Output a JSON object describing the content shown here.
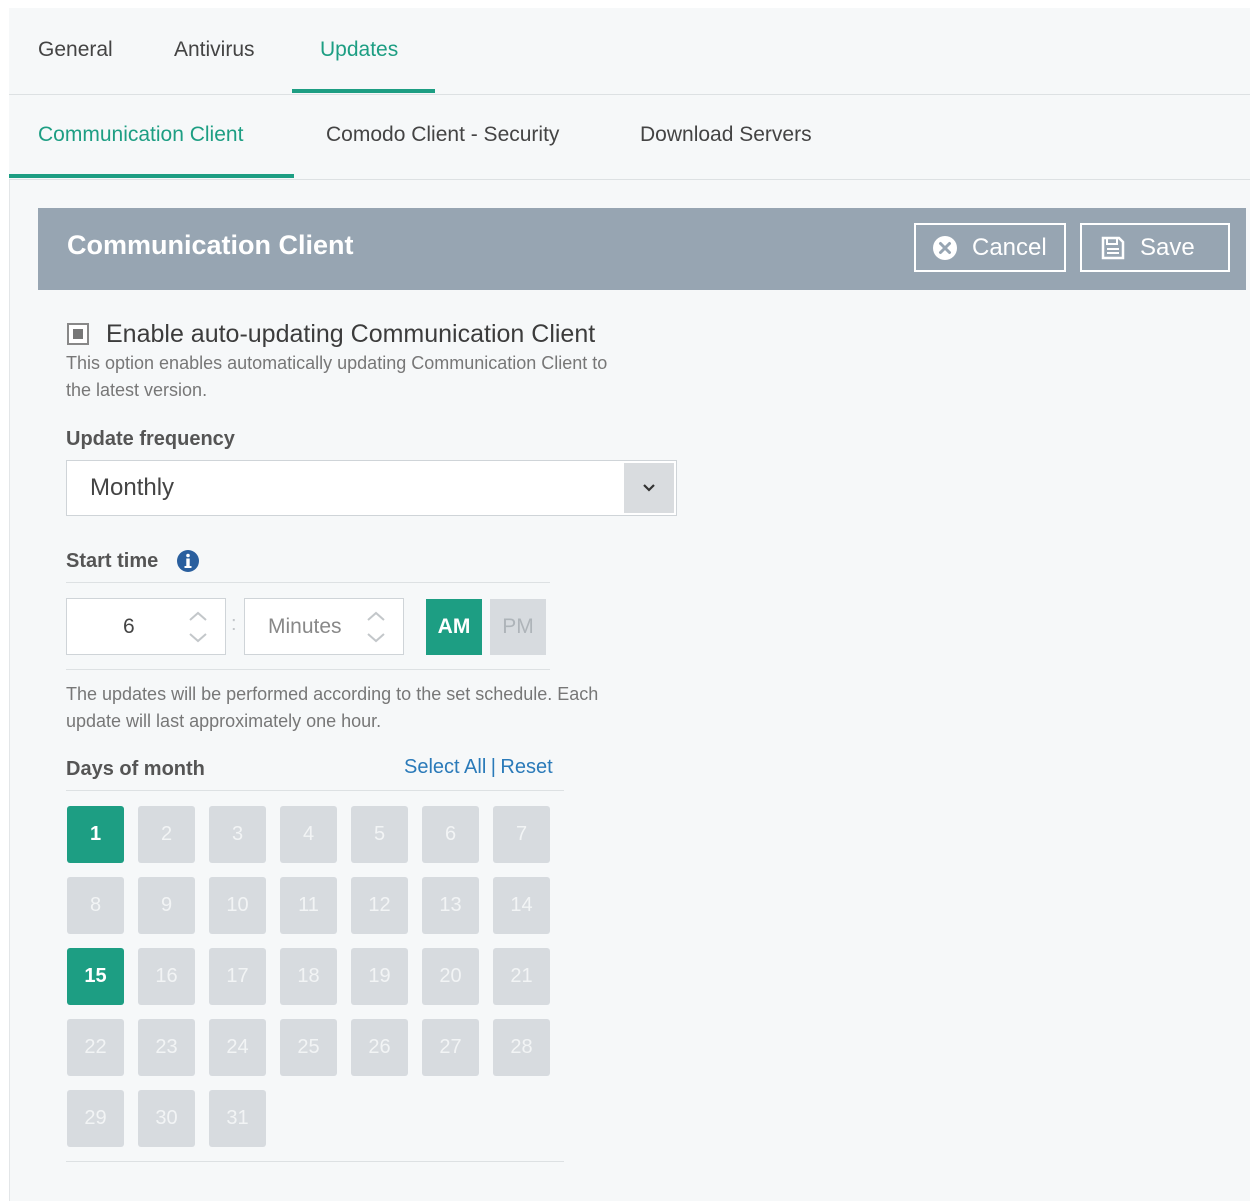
{
  "tabs_top": [
    {
      "label": "General",
      "active": false
    },
    {
      "label": "Antivirus",
      "active": false
    },
    {
      "label": "Updates",
      "active": true
    }
  ],
  "tabs_sub": [
    {
      "label": "Communication Client",
      "active": true
    },
    {
      "label": "Comodo Client - Security",
      "active": false
    },
    {
      "label": "Download Servers",
      "active": false
    }
  ],
  "panel": {
    "title": "Communication Client",
    "cancel_label": "Cancel",
    "save_label": "Save"
  },
  "auto_update": {
    "checked": true,
    "label": "Enable auto-updating Communication Client",
    "help_line1": "This option enables automatically updating Communication Client to",
    "help_line2": "the latest version."
  },
  "frequency": {
    "label": "Update frequency",
    "value": "Monthly"
  },
  "start_time": {
    "label": "Start time",
    "hour": "6",
    "minutes_placeholder": "Minutes",
    "separator": ":",
    "am_label": "AM",
    "pm_label": "PM",
    "selected": "AM",
    "note_line1": "The updates will be performed according to the set schedule. Each",
    "note_line2": "update will last approximately one hour."
  },
  "days": {
    "label": "Days of month",
    "select_all": "Select All",
    "divider": "|",
    "reset": "Reset",
    "values": [
      "1",
      "2",
      "3",
      "4",
      "5",
      "6",
      "7",
      "8",
      "9",
      "10",
      "11",
      "12",
      "13",
      "14",
      "15",
      "16",
      "17",
      "18",
      "19",
      "20",
      "21",
      "22",
      "23",
      "24",
      "25",
      "26",
      "27",
      "28",
      "29",
      "30",
      "31"
    ],
    "selected": [
      "1",
      "15"
    ]
  },
  "colors": {
    "accent": "#1d9e83",
    "header": "#97a5b2",
    "link": "#2a7ab9",
    "day_off": "#d7dbdf"
  }
}
